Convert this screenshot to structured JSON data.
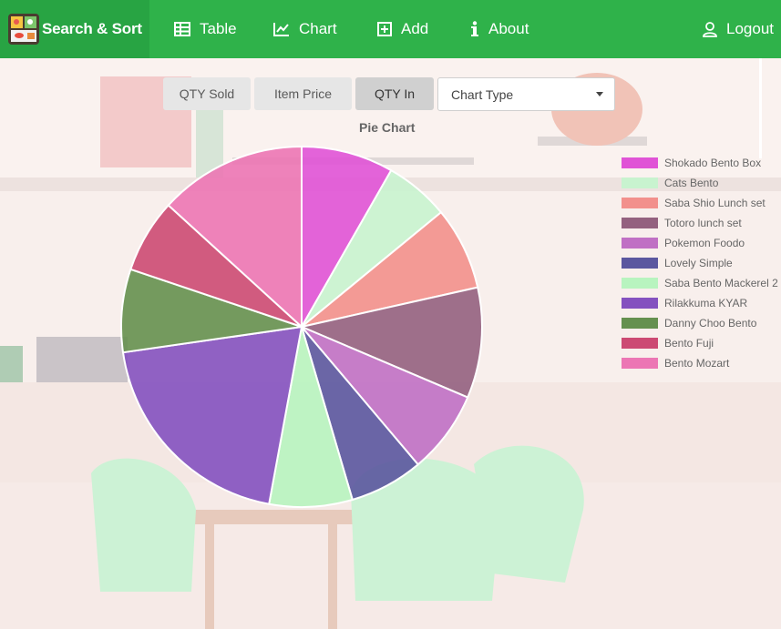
{
  "nav": {
    "brand": "Search & Sort",
    "table": "Table",
    "chart": "Chart",
    "add": "Add",
    "about": "About",
    "logout": "Logout",
    "color": "#2fb24a"
  },
  "controls": {
    "qty_sold": "QTY Sold",
    "item_price": "Item Price",
    "qty_in": "QTY In",
    "chart_type": "Chart Type"
  },
  "chart_data": {
    "type": "pie",
    "title": "Pie Chart",
    "legend_position": "right",
    "slices": [
      {
        "label": "Shokado Bento Box",
        "value": 10,
        "color": "#e053d6"
      },
      {
        "label": "Cats Bento",
        "value": 7,
        "color": "#c8f3cf"
      },
      {
        "label": "Saba Shio Lunch set",
        "value": 9,
        "color": "#f2908c"
      },
      {
        "label": "Totoro lunch set",
        "value": 12,
        "color": "#94617f"
      },
      {
        "label": "Pokemon Foodo",
        "value": 9,
        "color": "#c070c4"
      },
      {
        "label": "Lovely Simple",
        "value": 8,
        "color": "#5b579f"
      },
      {
        "label": "Saba Bento Mackerel 2",
        "value": 9,
        "color": "#b8f4bf"
      },
      {
        "label": "Rilakkuma KYAR",
        "value": 24,
        "color": "#8451bf"
      },
      {
        "label": "Danny Choo Bento",
        "value": 9,
        "color": "#65904f"
      },
      {
        "label": "Bento Fuji",
        "value": 8,
        "color": "#cc4a73"
      },
      {
        "label": "Bento Mozart",
        "value": 16,
        "color": "#ec76b4"
      }
    ]
  }
}
